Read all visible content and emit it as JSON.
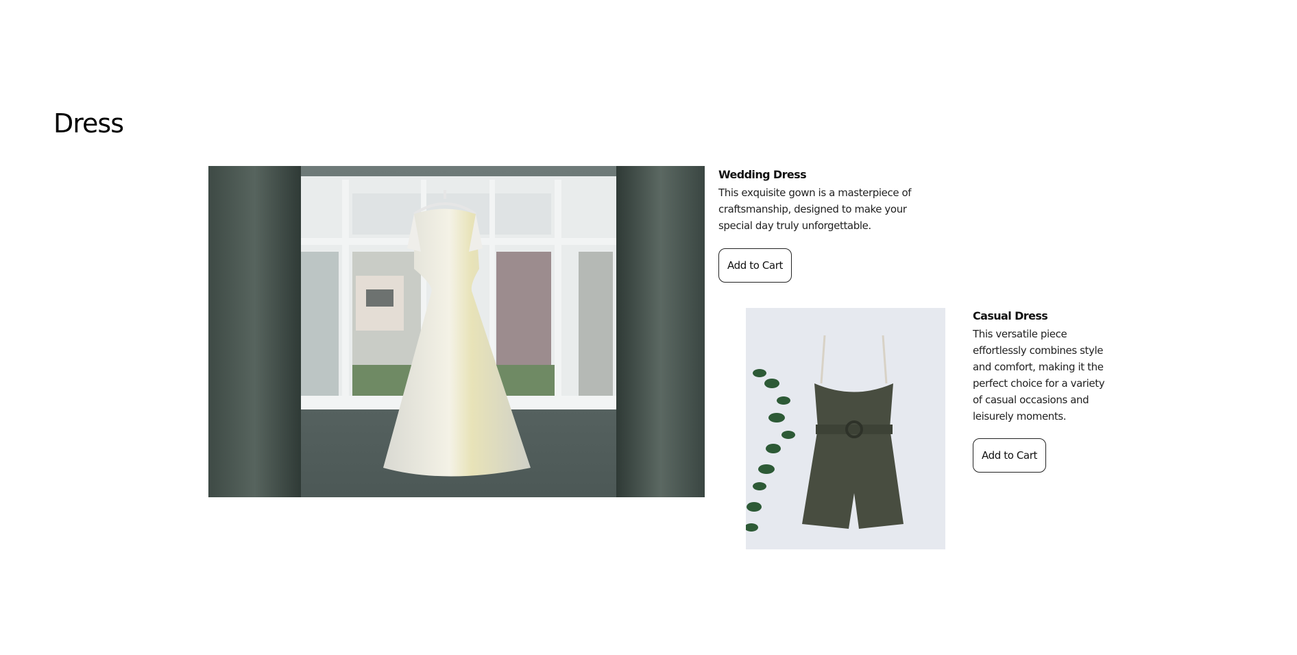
{
  "page": {
    "title": "Dress"
  },
  "products": [
    {
      "name": "Wedding Dress",
      "description": "This exquisite gown is a masterpiece of craftsmanship, designed to make your special day truly unforgettable.",
      "button_label": "Add to Cart",
      "image_alt": "wedding-dress-photo"
    },
    {
      "name": "Casual Dress",
      "description": "This versatile piece effortlessly combines style and comfort, making it the perfect choice for a variety of casual occasions and leisurely moments.",
      "button_label": "Add to Cart",
      "image_alt": "casual-dress-photo"
    }
  ],
  "colors": {
    "background": "#ffffff",
    "text": "#111111",
    "button_border": "#222222"
  }
}
